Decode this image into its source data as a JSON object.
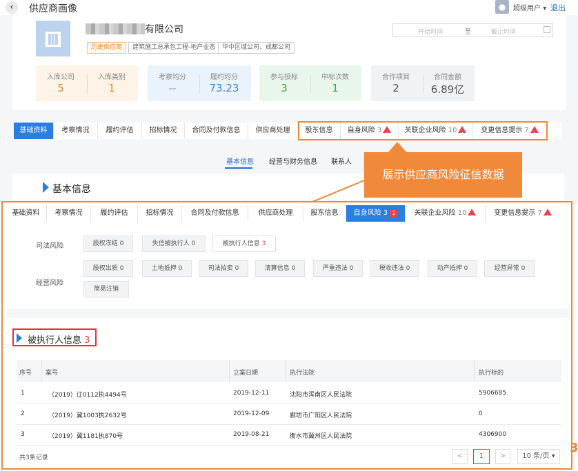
{
  "header": {
    "back_icon": "chevron-left",
    "title": "供应商画像",
    "user": "超级用户",
    "user_caret": "▾",
    "logout": "退出"
  },
  "company": {
    "name_suffix": "有限公司",
    "tags": [
      "历史供应商",
      "建筑施工总承包工程-地产业态",
      "华中区域公司、成都公司"
    ],
    "date_start_placeholder": "开始时间",
    "date_sep": "至",
    "date_end_placeholder": "截止时间",
    "stats": [
      {
        "label": "入库公司",
        "value": "5"
      },
      {
        "label": "入库类别",
        "value": "1"
      },
      {
        "label": "考察均分",
        "value": "--"
      },
      {
        "label": "履约均分",
        "value": "73.23"
      },
      {
        "label": "参与投标",
        "value": "3"
      },
      {
        "label": "中标次数",
        "value": "1"
      },
      {
        "label": "合作项目",
        "value": "2"
      },
      {
        "label": "合同金额",
        "value": "6.89亿"
      }
    ]
  },
  "tabs_top": [
    "基础资料",
    "考察情况",
    "履约评估",
    "招标情况",
    "合同及付款信息",
    "供应商处理",
    "股东信息",
    "自身风险",
    "关联企业风险",
    "变更信息提示"
  ],
  "tabs_top_counts": {
    "self_risk": "3",
    "related_risk": "10",
    "change_info": "7"
  },
  "subtabs": [
    "基本信息",
    "经营与财务信息",
    "联系人"
  ],
  "basic_title": "基本信息",
  "callout": "展示供应商风险征信数据",
  "tabs_zoom": [
    "基础资料",
    "考察情况",
    "履约评估",
    "招标情况",
    "合同及付款信息",
    "供应商处理",
    "股东信息",
    "自身风险",
    "关联企业风险",
    "变更信息提示"
  ],
  "tabs_zoom_counts": {
    "self_risk": "3",
    "self_risk_badge": "1",
    "related_risk": "10",
    "change_info": "7"
  },
  "risk": {
    "judicial_label": "司法风险",
    "judicial": [
      "股权冻结 0",
      "失信被执行人 0",
      "被执行人信息 "
    ],
    "judicial_exec_count": "3",
    "operation_label": "经营风险",
    "operation": [
      "股权出质 0",
      "土地抵押 0",
      "司法拍卖 0",
      "清算信息 0",
      "严重违法 0",
      "税收违法 0",
      "动产抵押 0",
      "经营异常 0",
      "简易注销"
    ]
  },
  "exec": {
    "title": "被执行人信息",
    "count": "3",
    "columns": [
      "序号",
      "案号",
      "立案日期",
      "执行法院",
      "执行标的"
    ],
    "rows": [
      [
        "1",
        "（2019）辽0112执4494号",
        "2019-12-11",
        "沈阳市浑南区人民法院",
        "5906685"
      ],
      [
        "2",
        "（2019）冀1003执2632号",
        "2019-12-09",
        "廊坊市广阳区人民法院",
        "0"
      ],
      [
        "3",
        "（2019）冀1181执870号",
        "2019-08-21",
        "衡水市冀州区人民法院",
        "4306900"
      ]
    ],
    "total": "共3条记录",
    "page_prev": "<",
    "page_current": "1",
    "page_next": ">",
    "page_size": "10 条/页",
    "page_size_caret": "▾"
  },
  "side_mark": "3",
  "colors": {
    "primary": "#2a7de1",
    "accent_orange": "#f1893b",
    "danger": "#e6434a"
  }
}
